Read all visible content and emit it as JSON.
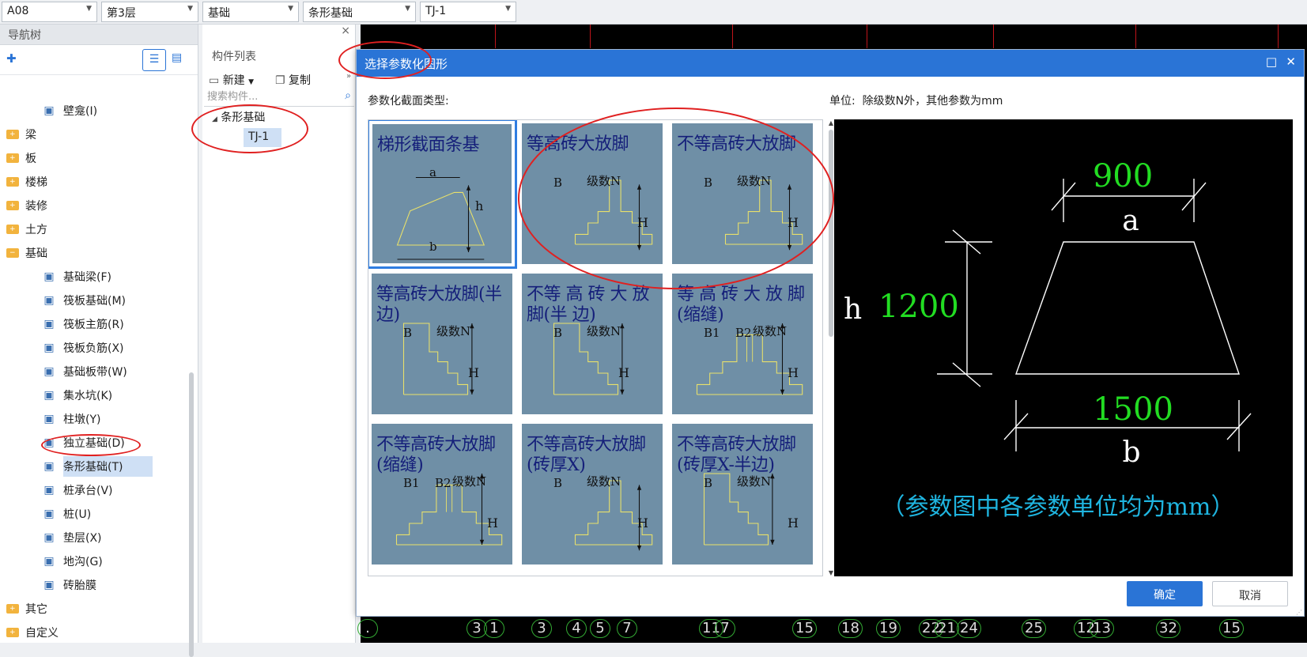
{
  "toolbar": {
    "floor_code": "A08",
    "layer": "第3层",
    "category": "基础",
    "type": "条形基础",
    "element": "TJ-1"
  },
  "nav": {
    "title": "导航树",
    "items": [
      {
        "label": "壁龛(I)",
        "kind": "leaf",
        "icon": "niche-icon"
      },
      {
        "label": "梁",
        "kind": "folder"
      },
      {
        "label": "板",
        "kind": "folder"
      },
      {
        "label": "楼梯",
        "kind": "folder"
      },
      {
        "label": "装修",
        "kind": "folder"
      },
      {
        "label": "土方",
        "kind": "folder"
      },
      {
        "label": "基础",
        "kind": "folder-open"
      },
      {
        "label": "基础梁(F)",
        "kind": "leaf",
        "icon": "foundation-beam-icon"
      },
      {
        "label": "筏板基础(M)",
        "kind": "leaf",
        "icon": "raft-foundation-icon"
      },
      {
        "label": "筏板主筋(R)",
        "kind": "leaf",
        "icon": "raft-main-rebar-icon"
      },
      {
        "label": "筏板负筋(X)",
        "kind": "leaf",
        "icon": "raft-negative-rebar-icon"
      },
      {
        "label": "基础板带(W)",
        "kind": "leaf",
        "icon": "foundation-strip-icon"
      },
      {
        "label": "集水坑(K)",
        "kind": "leaf",
        "icon": "sump-pit-icon"
      },
      {
        "label": "柱墩(Y)",
        "kind": "leaf",
        "icon": "column-pier-icon"
      },
      {
        "label": "独立基础(D)",
        "kind": "leaf",
        "icon": "isolated-footing-icon"
      },
      {
        "label": "条形基础(T)",
        "kind": "leaf",
        "icon": "strip-footing-icon",
        "selected": true
      },
      {
        "label": "桩承台(V)",
        "kind": "leaf",
        "icon": "pile-cap-icon"
      },
      {
        "label": "桩(U)",
        "kind": "leaf",
        "icon": "pile-icon"
      },
      {
        "label": "垫层(X)",
        "kind": "leaf",
        "icon": "cushion-icon"
      },
      {
        "label": "地沟(G)",
        "kind": "leaf",
        "icon": "trench-icon"
      },
      {
        "label": "砖胎膜",
        "kind": "leaf",
        "icon": "brick-mold-icon"
      },
      {
        "label": "其它",
        "kind": "folder"
      },
      {
        "label": "自定义",
        "kind": "folder"
      }
    ]
  },
  "components": {
    "title": "构件列表",
    "new_label": "新建",
    "copy_label": "复制",
    "search_placeholder": "搜索构件...",
    "group": "条形基础",
    "item": "TJ-1"
  },
  "dialog": {
    "title": "选择参数化图形",
    "section_label": "参数化截面类型:",
    "unit_label": "单位:",
    "unit_value": "除级数N外，其他参数为mm",
    "ok_label": "确定",
    "cancel_label": "取消",
    "tiles": [
      {
        "title": "梯形截面条基",
        "selected": true
      },
      {
        "title": "等高砖大放脚"
      },
      {
        "title": "不等高砖大放脚"
      },
      {
        "title": "等高砖大放脚(半边)"
      },
      {
        "title": "不等 高 砖 大 放脚(半 边)"
      },
      {
        "title": "等 高 砖 大 放 脚(缩缝)"
      },
      {
        "title": "不等高砖大放脚(缩缝)"
      },
      {
        "title": "不等高砖大放脚(砖厚X)"
      },
      {
        "title": "不等高砖大放脚(砖厚X-半边)"
      }
    ],
    "tile_labels": {
      "a": "a",
      "b": "b",
      "h": "h",
      "B": "B",
      "B1": "B1",
      "B2": "B2",
      "N": "级数N",
      "H": "H"
    },
    "preview": {
      "top_value": "900",
      "top_label": "a",
      "height_value": "1200",
      "height_label": "h",
      "bottom_value": "1500",
      "bottom_label": "b",
      "note": "（参数图中各参数单位均为mm）"
    }
  },
  "canvas": {
    "axis_labels": [
      ".",
      "3",
      "1",
      "3",
      "4",
      "5",
      "7",
      "11",
      "7",
      "15",
      "18",
      "19",
      "22",
      "21",
      "24",
      "25",
      "12",
      "13",
      "32",
      "15"
    ]
  },
  "colors": {
    "dialog_title_bg": "#2a74d6",
    "tile_bg": "#6f8fa6",
    "tile_title": "#151f7a",
    "preview_value": "#22dd22",
    "preview_note": "#1fb5e0",
    "annotation": "#e02020"
  }
}
